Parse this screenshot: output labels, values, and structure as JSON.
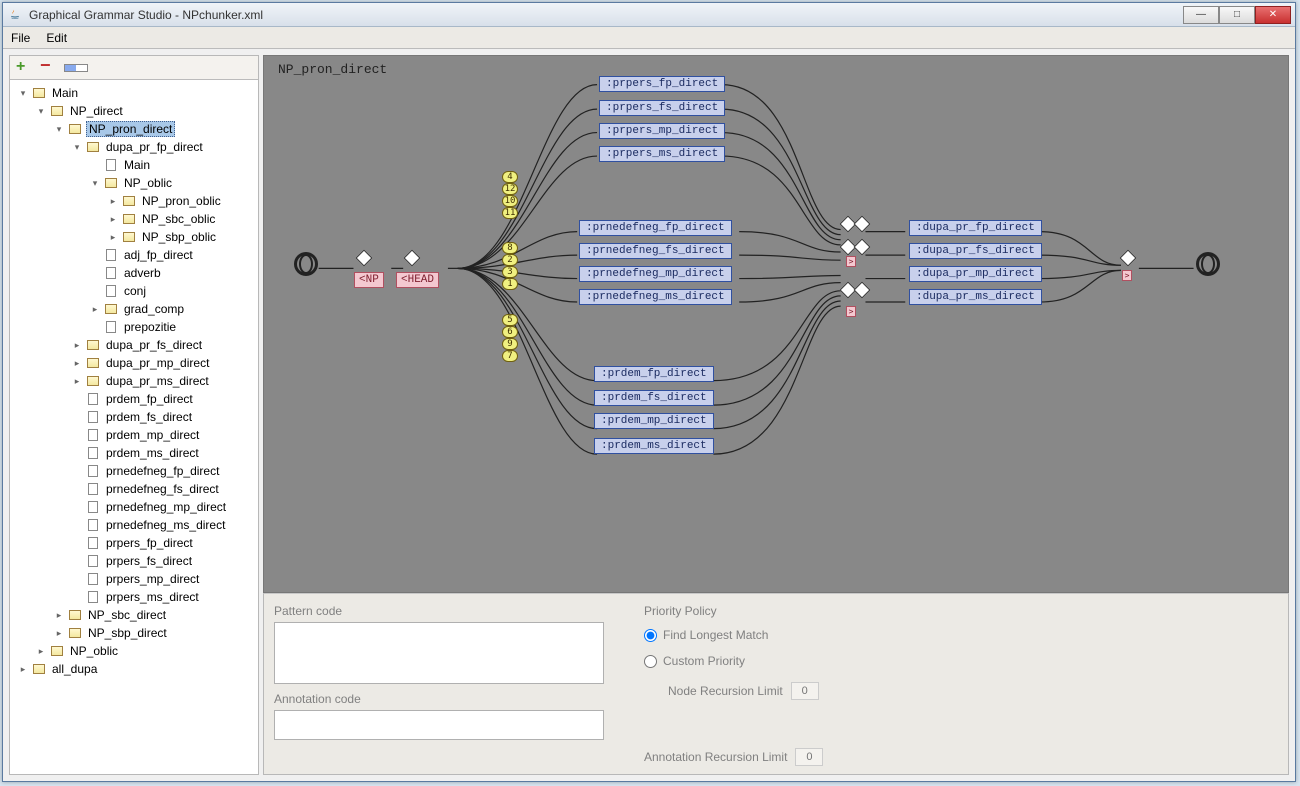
{
  "window": {
    "title": "Graphical Grammar Studio - NPchunker.xml"
  },
  "menu": {
    "file": "File",
    "edit": "Edit"
  },
  "tree": [
    {
      "d": 0,
      "t": "f",
      "exp": 1,
      "l": "Main"
    },
    {
      "d": 1,
      "t": "f",
      "exp": 1,
      "l": "NP_direct"
    },
    {
      "d": 2,
      "t": "f",
      "exp": 1,
      "l": "NP_pron_direct",
      "sel": 1
    },
    {
      "d": 3,
      "t": "f",
      "exp": 1,
      "l": "dupa_pr_fp_direct"
    },
    {
      "d": 4,
      "t": "d",
      "exp": 0,
      "l": "Main"
    },
    {
      "d": 4,
      "t": "f",
      "exp": 1,
      "l": "NP_oblic"
    },
    {
      "d": 5,
      "t": "f",
      "exp": 0,
      "l": "NP_pron_oblic"
    },
    {
      "d": 5,
      "t": "f",
      "exp": 0,
      "l": "NP_sbc_oblic"
    },
    {
      "d": 5,
      "t": "f",
      "exp": 0,
      "l": "NP_sbp_oblic"
    },
    {
      "d": 4,
      "t": "d",
      "exp": 0,
      "l": "adj_fp_direct"
    },
    {
      "d": 4,
      "t": "d",
      "exp": 0,
      "l": "adverb"
    },
    {
      "d": 4,
      "t": "d",
      "exp": 0,
      "l": "conj"
    },
    {
      "d": 4,
      "t": "f",
      "exp": 0,
      "l": "grad_comp"
    },
    {
      "d": 4,
      "t": "d",
      "exp": 0,
      "l": "prepozitie"
    },
    {
      "d": 3,
      "t": "f",
      "exp": 0,
      "l": "dupa_pr_fs_direct"
    },
    {
      "d": 3,
      "t": "f",
      "exp": 0,
      "l": "dupa_pr_mp_direct"
    },
    {
      "d": 3,
      "t": "f",
      "exp": 0,
      "l": "dupa_pr_ms_direct"
    },
    {
      "d": 3,
      "t": "d",
      "exp": 0,
      "l": "prdem_fp_direct"
    },
    {
      "d": 3,
      "t": "d",
      "exp": 0,
      "l": "prdem_fs_direct"
    },
    {
      "d": 3,
      "t": "d",
      "exp": 0,
      "l": "prdem_mp_direct"
    },
    {
      "d": 3,
      "t": "d",
      "exp": 0,
      "l": "prdem_ms_direct"
    },
    {
      "d": 3,
      "t": "d",
      "exp": 0,
      "l": "prnedefneg_fp_direct"
    },
    {
      "d": 3,
      "t": "d",
      "exp": 0,
      "l": "prnedefneg_fs_direct"
    },
    {
      "d": 3,
      "t": "d",
      "exp": 0,
      "l": "prnedefneg_mp_direct"
    },
    {
      "d": 3,
      "t": "d",
      "exp": 0,
      "l": "prnedefneg_ms_direct"
    },
    {
      "d": 3,
      "t": "d",
      "exp": 0,
      "l": "prpers_fp_direct"
    },
    {
      "d": 3,
      "t": "d",
      "exp": 0,
      "l": "prpers_fs_direct"
    },
    {
      "d": 3,
      "t": "d",
      "exp": 0,
      "l": "prpers_mp_direct"
    },
    {
      "d": 3,
      "t": "d",
      "exp": 0,
      "l": "prpers_ms_direct"
    },
    {
      "d": 2,
      "t": "f",
      "exp": 0,
      "l": "NP_sbc_direct"
    },
    {
      "d": 2,
      "t": "f",
      "exp": 0,
      "l": "NP_sbp_direct"
    },
    {
      "d": 1,
      "t": "f",
      "exp": 0,
      "l": "NP_oblic"
    },
    {
      "d": 0,
      "t": "f",
      "exp": 0,
      "l": "all_dupa"
    }
  ],
  "canvas": {
    "title": "NP_pron_direct",
    "tags": {
      "np": "<NP",
      "head": "<HEAD"
    },
    "col1": [
      ":prpers_fp_direct",
      ":prpers_fs_direct",
      ":prpers_mp_direct",
      ":prpers_ms_direct"
    ],
    "col2": [
      ":prnedefneg_fp_direct",
      ":prnedefneg_fs_direct",
      ":prnedefneg_mp_direct",
      ":prnedefneg_ms_direct"
    ],
    "col3": [
      ":prdem_fp_direct",
      ":prdem_fs_direct",
      ":prdem_mp_direct",
      ":prdem_ms_direct"
    ],
    "col4": [
      ":dupa_pr_fp_direct",
      ":dupa_pr_fs_direct",
      ":dupa_pr_mp_direct",
      ":dupa_pr_ms_direct"
    ],
    "prio1": [
      "4",
      "12",
      "10",
      "11"
    ],
    "prio2": [
      "8",
      "2",
      "3",
      "1"
    ],
    "prio3": [
      "5",
      "6",
      "9",
      "7"
    ],
    "gt": ">"
  },
  "bottom": {
    "pattern_label": "Pattern code",
    "annotation_label": "Annotation code",
    "policy_label": "Priority Policy",
    "opt_longest": "Find Longest Match",
    "opt_custom": "Custom Priority",
    "node_limit_label": "Node Recursion Limit",
    "anno_limit_label": "Annotation Recursion Limit",
    "limit_placeholder": "0"
  }
}
